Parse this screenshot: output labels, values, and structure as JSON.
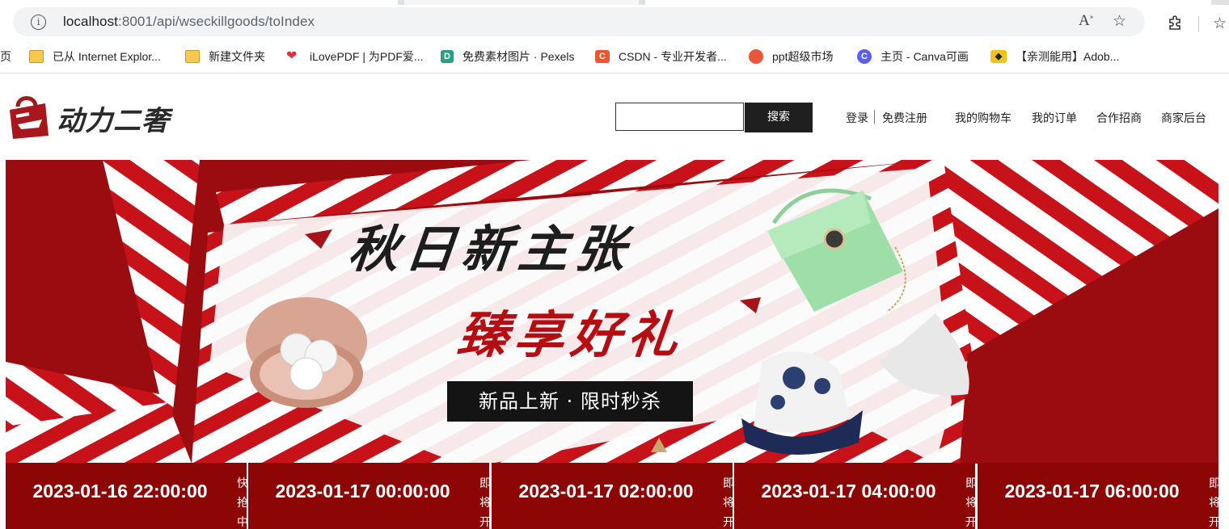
{
  "browser": {
    "url_host": "localhost",
    "url_rest": ":8001/api/wseckillgoods/toIndex",
    "bookmarks": [
      {
        "label": "页",
        "icon": "none"
      },
      {
        "label": "已从 Internet Explor...",
        "icon": "folder-icon"
      },
      {
        "label": "新建文件夹",
        "icon": "folder-icon"
      },
      {
        "label": "iLovePDF | 为PDF爱...",
        "icon": "heart-icon"
      },
      {
        "label": "免费素材图片 · Pexels",
        "icon": "pexels-icon"
      },
      {
        "label": "CSDN - 专业开发者...",
        "icon": "csdn-icon"
      },
      {
        "label": "ppt超级市场",
        "icon": "ppt-icon"
      },
      {
        "label": "主页 - Canva可画",
        "icon": "canva-icon"
      },
      {
        "label": "【亲测能用】Adob...",
        "icon": "adobe-icon"
      }
    ]
  },
  "header": {
    "logo_text": "动力二奢",
    "search_button": "搜索",
    "search_placeholder": "",
    "nav": [
      "登录",
      "免费注册",
      "我的购物车",
      "我的订单",
      "合作招商",
      "商家后台"
    ]
  },
  "banner": {
    "title": "秋日新主张",
    "subtitle": "臻享好礼",
    "tag": "新品上新 · 限时秒杀"
  },
  "seckill_slots": [
    {
      "time": "2023-01-16 22:00:00",
      "status": "快抢中"
    },
    {
      "time": "2023-01-17 00:00:00",
      "status": "即将开"
    },
    {
      "time": "2023-01-17 02:00:00",
      "status": "即将开"
    },
    {
      "time": "2023-01-17 04:00:00",
      "status": "即将开"
    },
    {
      "time": "2023-01-17 06:00:00",
      "status": "即将开"
    }
  ],
  "colors": {
    "brand_red": "#b50d12",
    "timebar_red": "#8c0606",
    "search_btn": "#1f1f1f"
  }
}
